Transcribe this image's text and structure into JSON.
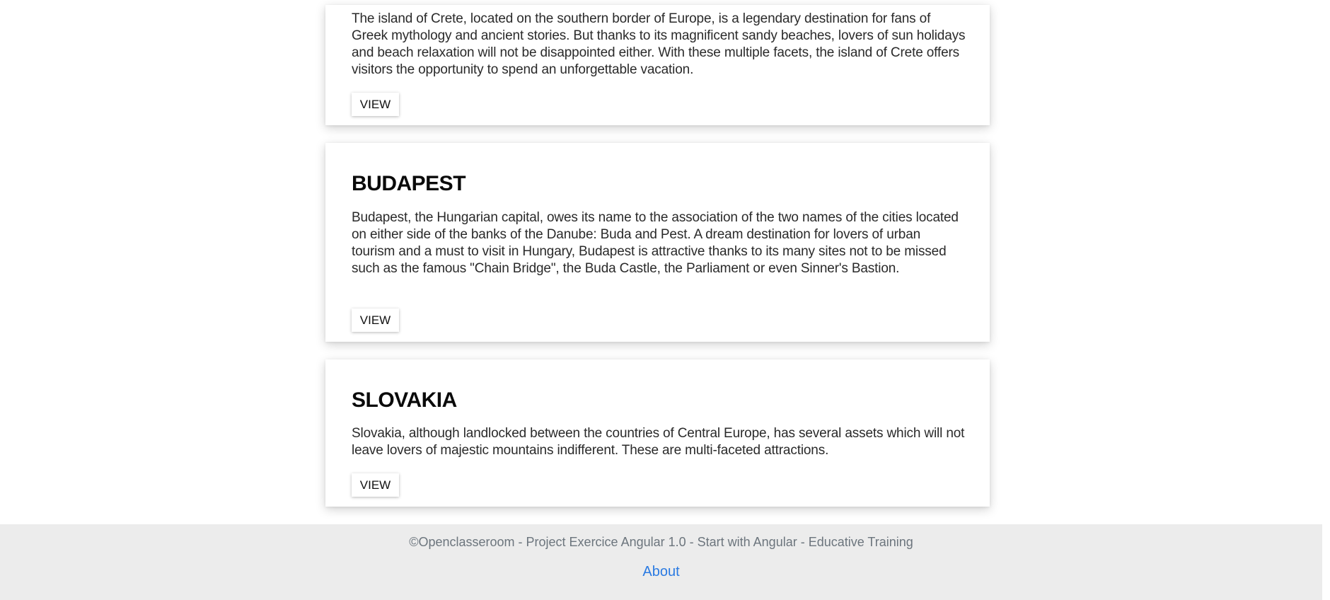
{
  "destinations": [
    {
      "title": "",
      "description": "The island of Crete, located on the southern border of Europe, is a legendary destination for fans of Greek mythology and ancient stories. But thanks to its magnificent sandy beaches, lovers of sun holidays and beach relaxation will not be disappointed either. With these multiple facets, the island of Crete offers visitors the opportunity to spend an unforgettable vacation.",
      "button_label": "VIEW"
    },
    {
      "title": "BUDAPEST",
      "description": "Budapest, the Hungarian capital, owes its name to the association of the two names of the cities located on either side of the banks of the Danube: Buda and Pest. A dream destination for lovers of urban tourism and a must to visit in Hungary, Budapest is attractive thanks to its many sites not to be missed such as the famous \"Chain Bridge\", the Buda Castle, the Parliament or even Sinner's Bastion.",
      "button_label": "VIEW"
    },
    {
      "title": "SLOVAKIA",
      "description": "Slovakia, although landlocked between the countries of Central Europe, has several assets which will not leave lovers of majestic mountains indifferent. These are multi-faceted attractions.",
      "button_label": "VIEW"
    }
  ],
  "footer": {
    "copyright": "©Openclasseroom - Project Exercice Angular 1.0 - Start with Angular - Educative Training",
    "about_link": "About"
  },
  "colors": {
    "footer_background": "#ececec",
    "link": "#2a7ae2",
    "footer_text": "#6c757d"
  }
}
